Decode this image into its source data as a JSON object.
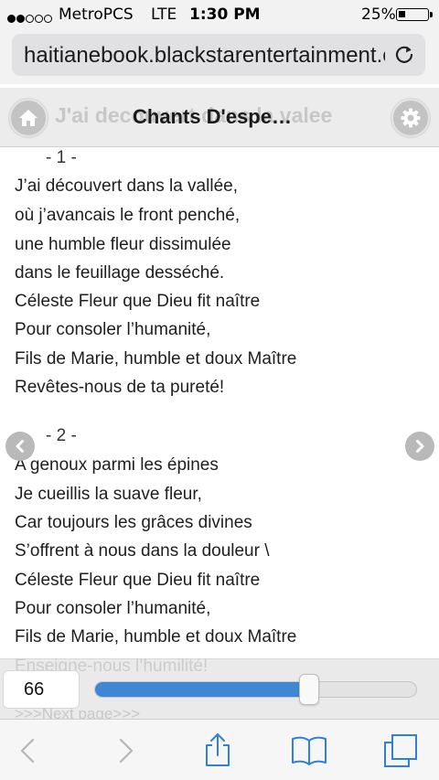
{
  "status_bar": {
    "carrier": "MetroPCS",
    "network": "LTE",
    "time": "1:30 PM",
    "battery_percent_label": "25%",
    "battery_level": 0.25,
    "signal_bars_filled": 2,
    "signal_bars_total": 5
  },
  "browser": {
    "url": "haitianebook.blackstarentertainment.com",
    "reload_icon": "reload-icon"
  },
  "app_header": {
    "title": "Chants D'espe…",
    "ghost_title": "J'ai decouvert dans la valee",
    "home_icon": "home-icon",
    "settings_icon": "gear-icon"
  },
  "lyrics": {
    "stanzas": [
      {
        "number": "- 1 -",
        "lines": [
          "J’ai découvert dans la vallée,",
          "où j’avancais le front penché,",
          "une humble fleur dissimulée",
          "dans le feuillage desséché.",
          "Céleste Fleur que Dieu fit naître",
          "Pour consoler l’humanité,",
          "Fils de Marie, humble et doux Maître",
          "Revêtes-nous de ta pureté!"
        ]
      },
      {
        "number": "- 2 -",
        "lines": [
          "A genoux parmi les épines",
          "Je cueillis la suave fleur,",
          "Car toujours les grâces divines",
          "S’offrent à nous dans la douleur \\",
          "Céleste Fleur que Dieu fit naître",
          "Pour consoler l’humanité,",
          "Fils de Marie, humble et doux Maître"
        ]
      }
    ],
    "faded_lines": [
      "Enseigne-nous l’humilité!",
      ">>>Next page>>>"
    ]
  },
  "font_size_slider": {
    "value": "66",
    "fill_fraction": 0.66
  },
  "toolbar": {
    "icons": [
      "back-icon",
      "forward-icon",
      "share-icon",
      "bookmarks-icon",
      "tabs-icon"
    ]
  },
  "colors": {
    "accent": "#3f86d4",
    "toolbar_icon": "#2f80d8",
    "toolbar_icon_disabled": "#b5b5b5"
  }
}
